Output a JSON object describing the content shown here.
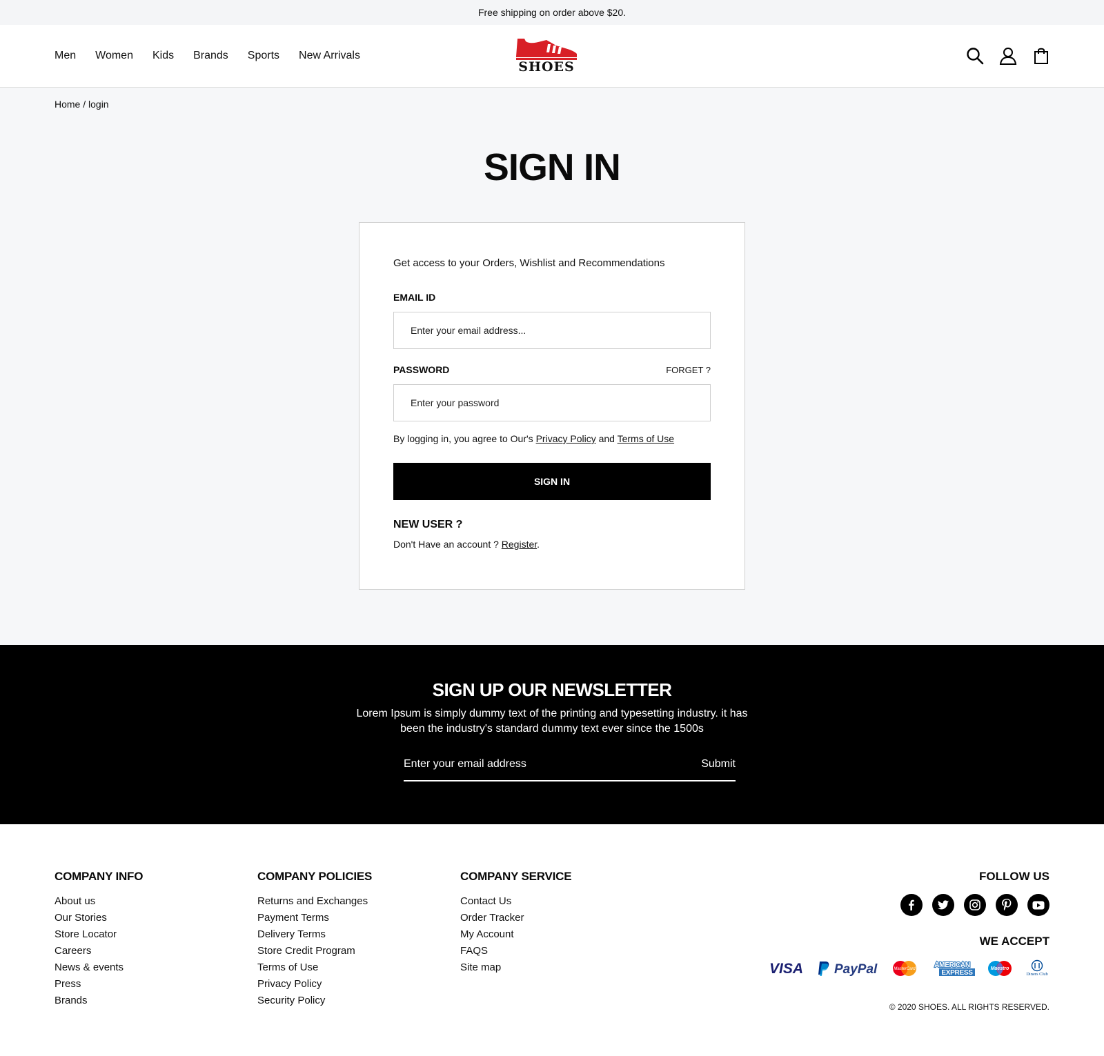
{
  "topbar": {
    "text": "Free shipping on order above $20."
  },
  "nav": {
    "links": [
      "Men",
      "Women",
      "Kids",
      "Brands",
      "Sports",
      "New Arrivals"
    ],
    "logo_text": "SHOES"
  },
  "breadcrumb": {
    "text": "Home / login"
  },
  "page_title": "SIGN IN",
  "signin": {
    "intro": "Get access to your Orders, Wishlist and Recommendations",
    "email_label": "EMAIL ID",
    "email_placeholder": "Enter your email address...",
    "password_label": "PASSWORD",
    "forgot_label": "FORGET ?",
    "password_placeholder": "Enter your password",
    "terms_prefix": "By logging in, you agree to Our's ",
    "privacy_link": "Privacy Policy",
    "terms_and": " and ",
    "terms_link": "Terms of Use",
    "button_label": "SIGN IN",
    "new_user_title": "NEW USER ?",
    "new_user_prefix": "Don't Have an account ? ",
    "register_link": "Register",
    "new_user_suffix": "."
  },
  "newsletter": {
    "title": "SIGN UP OUR NEWSLETTER",
    "description": "Lorem Ipsum is simply dummy text of the printing and typesetting industry. it has been the industry's standard dummy text ever since the 1500s",
    "placeholder": "Enter your email address",
    "submit_label": "Submit"
  },
  "footer": {
    "company_info": {
      "title": "COMPANY INFO",
      "items": [
        "About us",
        "Our Stories",
        "Store Locator",
        "Careers",
        "News & events",
        "Press",
        "Brands"
      ]
    },
    "company_policies": {
      "title": "COMPANY POLICIES",
      "items": [
        "Returns and Exchanges",
        "Payment Terms",
        "Delivery Terms",
        "Store Credit Program",
        "Terms of Use",
        "Privacy Policy",
        "Security Policy"
      ]
    },
    "company_service": {
      "title": "COMPANY SERVICE",
      "items": [
        "Contact Us",
        "Order Tracker",
        "My Account",
        "FAQS",
        "Site map"
      ]
    },
    "follow_title": "FOLLOW US",
    "socials": [
      "facebook-icon",
      "twitter-icon",
      "instagram-icon",
      "pinterest-icon",
      "youtube-icon"
    ],
    "accept_title": "WE ACCEPT",
    "payment_methods": {
      "visa": "VISA",
      "paypal": "PayPal",
      "mastercard": "MasterCard",
      "amex_1": "AMERICAN",
      "amex_2": "EXPRESS",
      "maestro": "Maestro",
      "diners": "Diners Club"
    },
    "copyright": "© 2020 SHOES. ALL RIGHTS RESERVED."
  },
  "colors": {
    "brand_red": "#d81f26",
    "black": "#000000",
    "page_bg": "#f6f7f9"
  }
}
